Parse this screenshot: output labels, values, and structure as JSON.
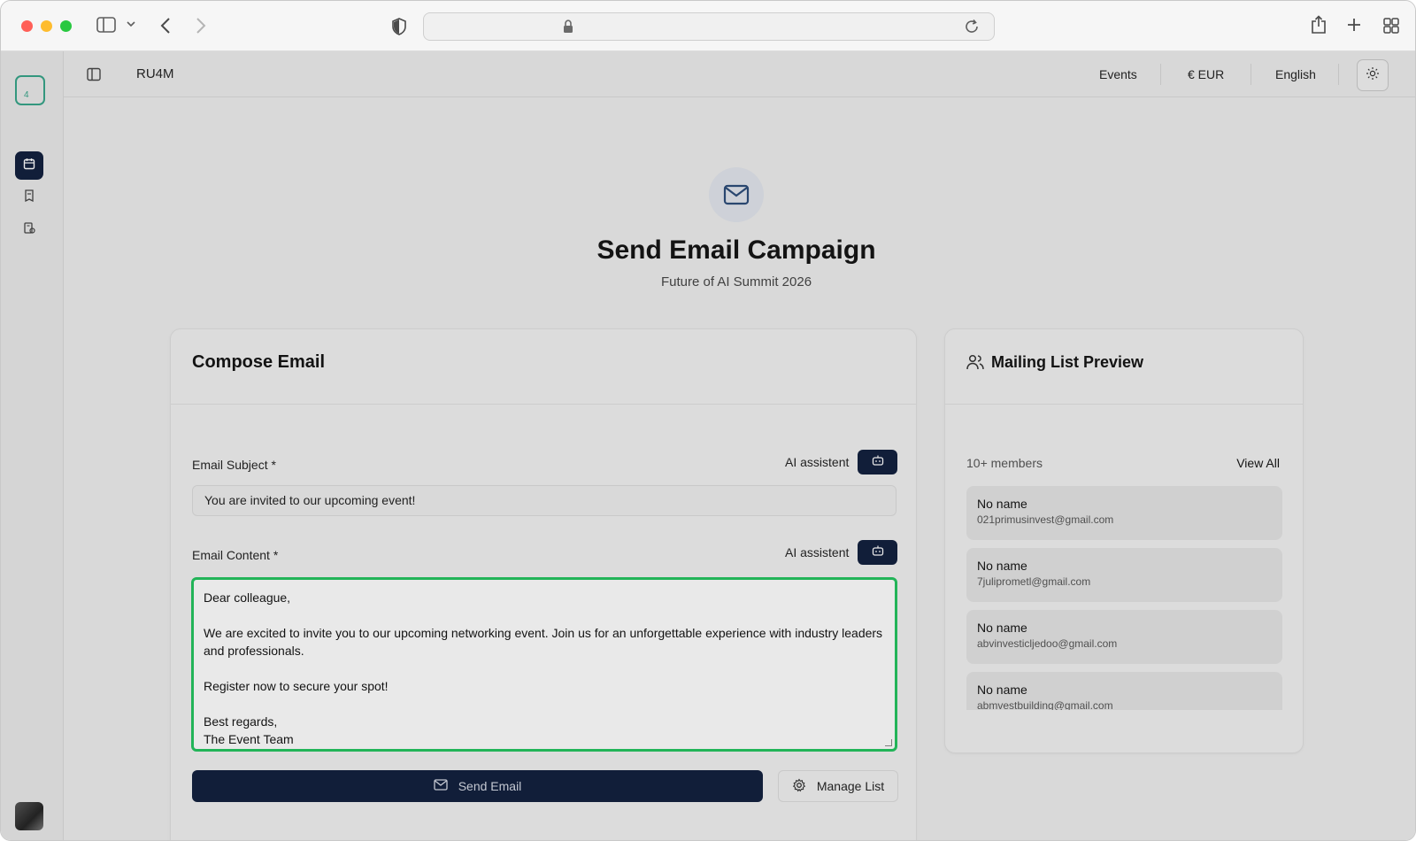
{
  "browser": {
    "url": ""
  },
  "app": {
    "brand": "RU4M",
    "logo_text": "4",
    "nav": {
      "events": "Events",
      "currency": "€ EUR",
      "language": "English"
    }
  },
  "hero": {
    "title": "Send Email Campaign",
    "subtitle": "Future of AI Summit 2026"
  },
  "compose": {
    "title": "Compose Email",
    "subject_label": "Email Subject *",
    "content_label": "Email Content *",
    "ai_label": "AI assistent",
    "subject_value": "You are invited to our upcoming event!",
    "content_value": "Dear colleague,\n\nWe are excited to invite you to our upcoming networking event. Join us for an unforgettable experience with industry leaders and professionals.\n\nRegister now to secure your spot!\n\nBest regards,\nThe Event Team",
    "send_label": "Send Email",
    "manage_label": "Manage List"
  },
  "mailing": {
    "title": "Mailing List Preview",
    "members_count": "10+ members",
    "view_all": "View All",
    "members": [
      {
        "name": "No name",
        "email": "021primusinvest@gmail.com"
      },
      {
        "name": "No name",
        "email": "7juliprometl@gmail.com"
      },
      {
        "name": "No name",
        "email": "abvinvesticljedoo@gmail.com"
      },
      {
        "name": "No name",
        "email": "abmvestbuilding@gmail.com"
      }
    ]
  },
  "colors": {
    "accent": "#0f1d3b",
    "focus": "#22c55e",
    "logo": "#35a488"
  }
}
